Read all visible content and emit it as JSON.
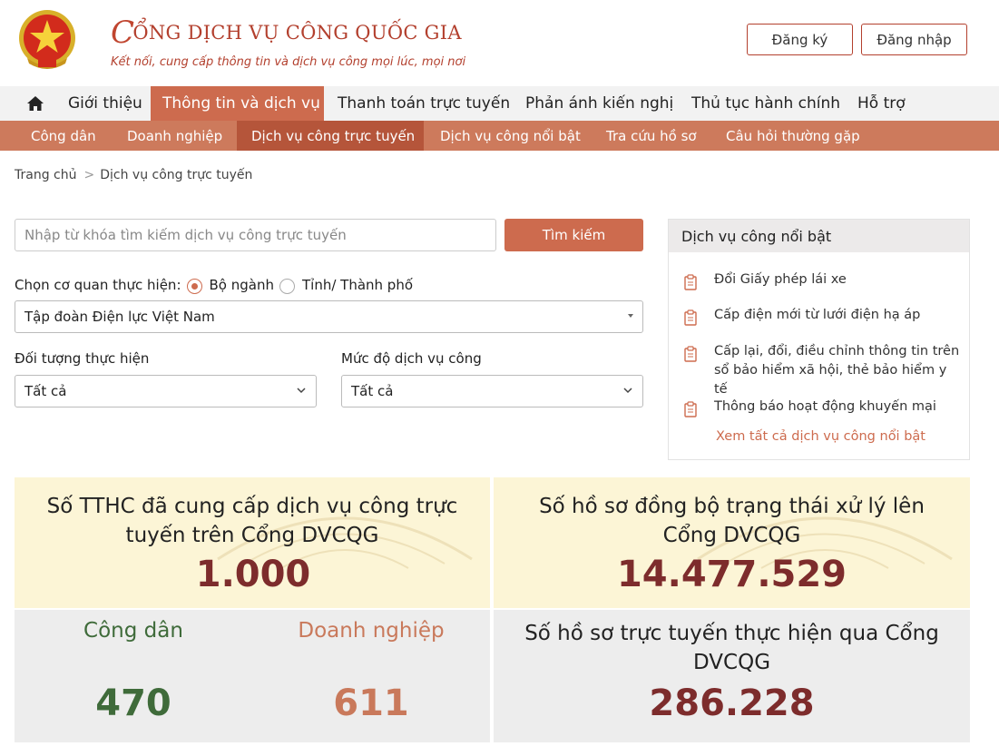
{
  "header": {
    "title": "CỔNG DỊCH VỤ CÔNG QUỐC GIA",
    "title_first": "C",
    "title_rest": "ỔNG DỊCH VỤ CÔNG QUỐC GIA",
    "subtitle": "Kết nối, cung cấp thông tin và dịch vụ công mọi lúc, mọi nơi",
    "register_label": "Đăng ký",
    "login_label": "Đăng nhập"
  },
  "main_nav": {
    "items": [
      "Giới thiệu",
      "Thông tin và dịch vụ",
      "Thanh toán trực tuyến",
      "Phản ánh kiến nghị",
      "Thủ tục hành chính",
      "Hỗ trợ"
    ],
    "active": "Thông tin và dịch vụ"
  },
  "sub_nav": {
    "items": [
      "Công dân",
      "Doanh nghiệp",
      "Dịch vụ công trực tuyến",
      "Dịch vụ công nổi bật",
      "Tra cứu hồ sơ",
      "Câu hỏi thường gặp"
    ],
    "active": "Dịch vụ công trực tuyến"
  },
  "breadcrumb": {
    "home": "Trang chủ",
    "separator": ">",
    "current": "Dịch vụ công trực tuyến"
  },
  "search": {
    "placeholder": "Nhập từ khóa tìm kiếm dịch vụ công trực tuyến",
    "button_label": "Tìm kiếm"
  },
  "agency": {
    "label": "Chọn cơ quan thực hiện:",
    "option_ministry": "Bộ ngành",
    "option_province": "Tỉnh/ Thành phố",
    "selected_option": "Bộ ngành",
    "selected_agency": "Tập đoàn Điện lực Việt Nam"
  },
  "filters": {
    "target_label": "Đối tượng thực hiện",
    "target_value": "Tất cả",
    "level_label": "Mức độ dịch vụ công",
    "level_value": "Tất cả"
  },
  "featured": {
    "title": "Dịch vụ công nổi bật",
    "items": [
      "Đổi Giấy phép lái xe",
      "Cấp điện mới từ lưới điện hạ áp",
      "Cấp lại, đổi, điều chỉnh thông tin trên sổ bảo hiểm xã hội, thẻ bảo hiểm y tế",
      "Thông báo hoạt động khuyến mại"
    ],
    "more_label": "Xem tất cả dịch vụ công nổi bật"
  },
  "stats": {
    "tthc_title": "Số TTHC đã cung cấp dịch vụ công trực tuyến trên Cổng DVCQG",
    "tthc_value": "1.000",
    "sync_title": "Số hồ sơ đồng bộ trạng thái xử lý lên Cổng DVCQG",
    "sync_value": "14.477.529",
    "citizen_label": "Công dân",
    "citizen_value": "470",
    "business_label": "Doanh nghiệp",
    "business_value": "611",
    "online_title": "Số hồ sơ trực tuyến thực hiện qua Cổng DVCQG",
    "online_value": "286.228"
  },
  "colors": {
    "accent": "#cd6b4e",
    "subnav_bg": "#cd7a5c",
    "number_red": "#7d2c2c",
    "citizen_green": "#3f6b3a",
    "business_orange": "#c9795b",
    "stat_yellow": "#fcf5d6"
  }
}
